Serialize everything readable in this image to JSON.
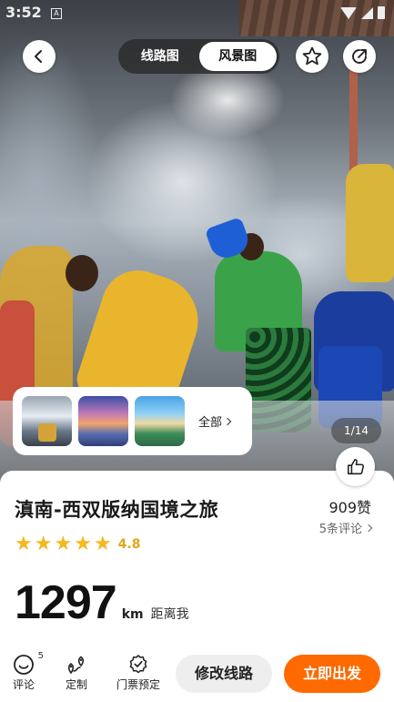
{
  "status_bar": {
    "time": "3:52",
    "sim_label": "A"
  },
  "header": {
    "segments": [
      {
        "label": "线路图",
        "active": false
      },
      {
        "label": "风景图",
        "active": true
      }
    ]
  },
  "gallery": {
    "all_label": "全部",
    "counter": "1/14"
  },
  "route": {
    "title": "滇南-西双版纳国境之旅",
    "likes": "909赞",
    "reviews_link": "5条评论",
    "rating_value": "4.8",
    "rating_stars": 5,
    "distance_value": "1297",
    "distance_unit": "km",
    "distance_label": "距离我"
  },
  "toolbar": {
    "review_label": "评论",
    "review_count": "5",
    "custom_label": "定制",
    "ticket_label": "门票预定",
    "edit_button": "修改线路",
    "go_button": "立即出发"
  },
  "colors": {
    "accent": "#ff6a00",
    "star": "#f5b820",
    "rating_text": "#e3a51a"
  }
}
